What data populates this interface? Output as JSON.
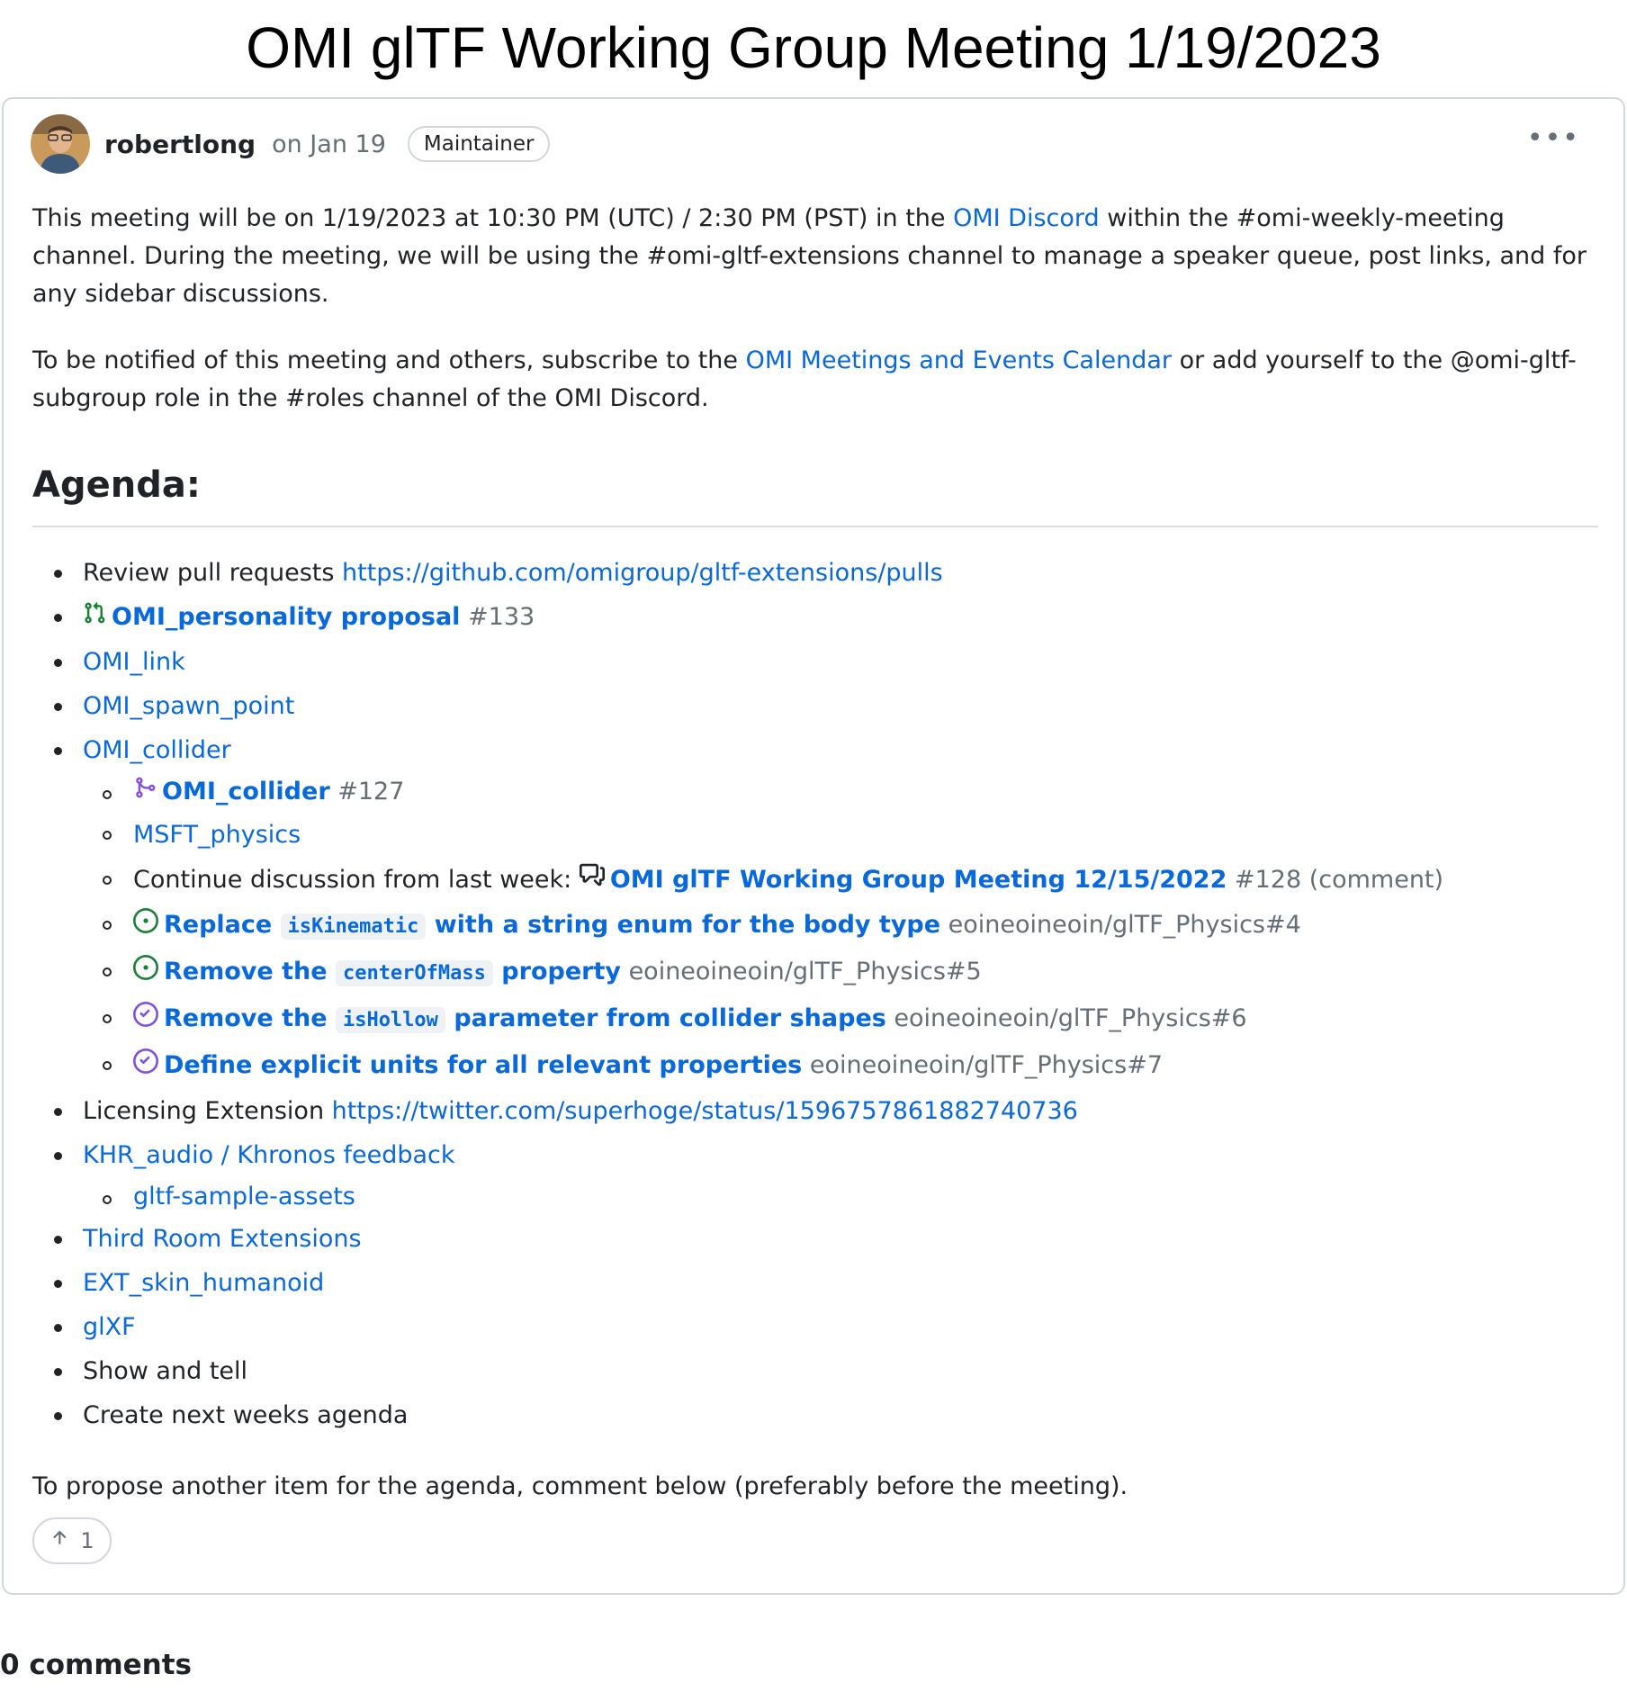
{
  "page": {
    "title": "OMI glTF Working Group Meeting 1/19/2023"
  },
  "post": {
    "author": "robertlong",
    "date": "on Jan 19",
    "badge": "Maintainer",
    "more_label": "•••",
    "intro": {
      "p1_a": "This meeting will be on 1/19/2023 at 10:30 PM (UTC) / 2:30 PM (PST) in the ",
      "p1_link": "OMI Discord",
      "p1_b": " within the #omi-weekly-meeting channel. During the meeting, we will be using the #omi-gltf-extensions channel to manage a speaker queue, post links, and for any sidebar discussions.",
      "p2_a": "To be notified of this meeting and others, subscribe to the ",
      "p2_link": "OMI Meetings and Events Calendar",
      "p2_b": " or add yourself to the @omi-gltf-subgroup role in the #roles channel of the OMI Discord."
    },
    "agenda_heading": "Agenda:",
    "agenda": {
      "review_text": "Review pull requests ",
      "review_link": "https://github.com/omigroup/gltf-extensions/pulls",
      "personality_title": "OMI_personality proposal",
      "personality_num": "#133",
      "link": "OMI_link",
      "spawn_point": "OMI_spawn_point",
      "collider": "OMI_collider",
      "collider_sub": {
        "pr_title": "OMI_collider",
        "pr_num": "#127",
        "msft": "MSFT_physics",
        "continue_text": "Continue discussion from last week: ",
        "discussion_title": "OMI glTF Working Group Meeting 12/15/2022",
        "discussion_num": "#128 (comment)",
        "issue4_a": "Replace ",
        "issue4_code": "isKinematic",
        "issue4_b": " with a string enum for the body type",
        "issue4_ref": "eoineoineoin/glTF_Physics#4",
        "issue5_a": "Remove the ",
        "issue5_code": "centerOfMass",
        "issue5_b": " property",
        "issue5_ref": "eoineoineoin/glTF_Physics#5",
        "issue6_a": "Remove the ",
        "issue6_code": "isHollow",
        "issue6_b": " parameter from collider shapes",
        "issue6_ref": "eoineoineoin/glTF_Physics#6",
        "issue7_title": "Define explicit units for all relevant properties",
        "issue7_ref": "eoineoineoin/glTF_Physics#7"
      },
      "licensing_text": "Licensing Extension ",
      "licensing_link": "https://twitter.com/superhoge/status/1596757861882740736",
      "khr_audio": "KHR_audio / Khronos feedback",
      "sample_assets": "gltf-sample-assets",
      "third_room": "Third Room Extensions",
      "skin_humanoid": "EXT_skin_humanoid",
      "glxf": "glXF",
      "show_tell": "Show and tell",
      "next_agenda": "Create next weeks agenda"
    },
    "footer_text": "To propose another item for the agenda, comment below (preferably before the meeting).",
    "upvote_count": "1"
  },
  "comments": {
    "count_label": "0 comments"
  },
  "colors": {
    "link": "#0969da",
    "muted": "#656d76",
    "open_green": "#1a7f37",
    "done_purple": "#8250df",
    "border": "#d0d7de"
  }
}
